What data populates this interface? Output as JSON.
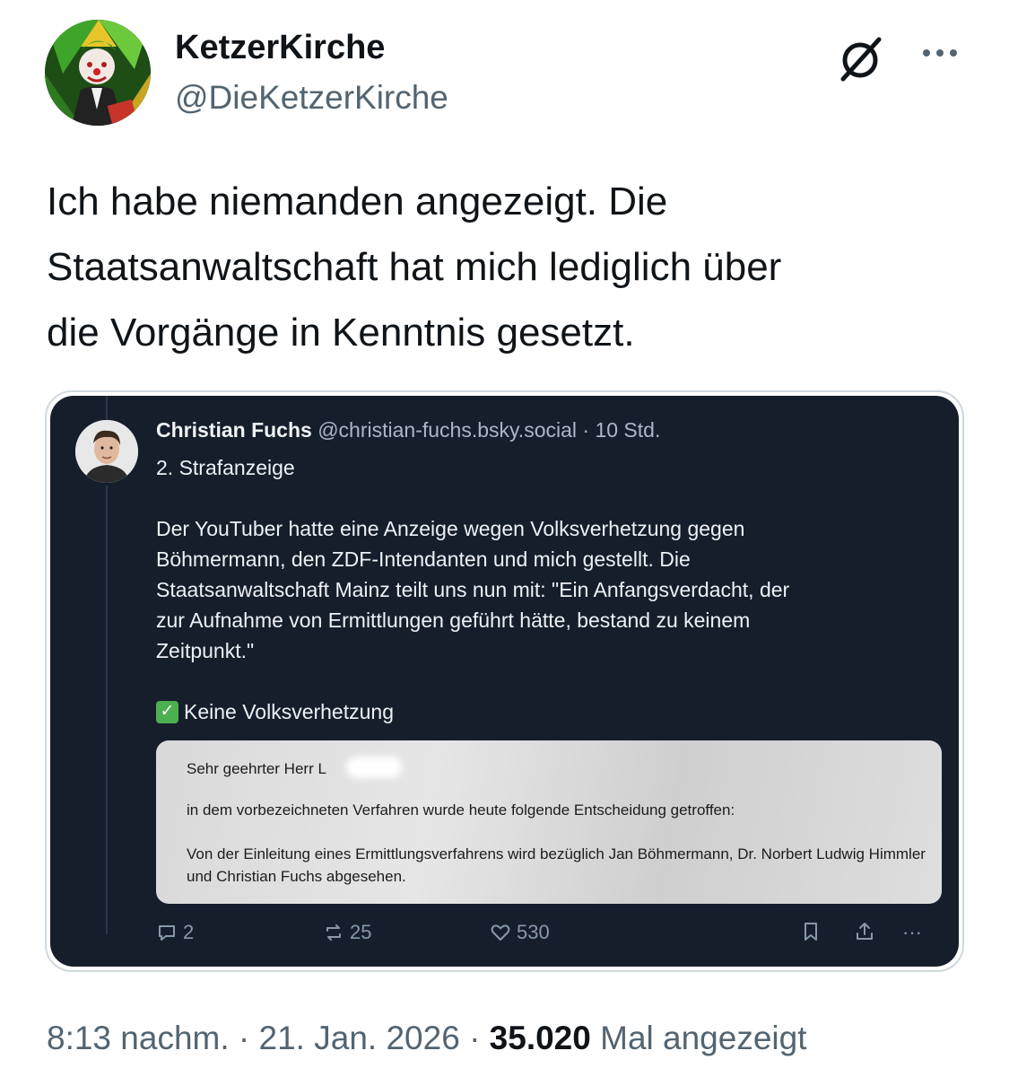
{
  "author": {
    "display_name": "KetzerKirche",
    "handle": "@DieKetzerKirche"
  },
  "tweet": {
    "text": "Ich habe niemanden angezeigt. Die\nStaatsanwaltschaft hat mich lediglich über\ndie Vorgänge in Kenntnis gesetzt."
  },
  "embed": {
    "name": "Christian Fuchs",
    "handle": "@christian-fuchs.bsky.social",
    "separator": "·",
    "time": "10 Std.",
    "line1": "2. Strafanzeige",
    "paragraph": "Der YouTuber hatte eine Anzeige wegen Volksverhetzung gegen\nBöhmermann, den ZDF-Intendanten und mich gestellt. Die\nStaatsanwaltschaft Mainz teilt uns nun mit: \"Ein Anfangsverdacht, der\nzur Aufnahme von Ermittlungen geführt hätte, bestand zu keinem\nZeitpunkt.\"",
    "check_label": "Keine Volksverhetzung",
    "check_mark": "✓",
    "letter": {
      "salutation": "Sehr geehrter Herr L",
      "line2": "in dem vorbezeichneten Verfahren wurde heute folgende Entscheidung getroffen:",
      "line3": "Von der Einleitung eines Ermittlungsverfahrens wird  bezüglich Jan Böhmermann, Dr. Norbert Ludwig Himmler und Christian Fuchs abgesehen."
    },
    "actions": {
      "replies": "2",
      "reposts": "25",
      "likes": "530",
      "more": "···"
    }
  },
  "meta": {
    "time": "8:13 nachm.",
    "dot1": "·",
    "date": "21. Jan. 2026",
    "dot2": "·",
    "views": "35.020",
    "views_label": "Mal angezeigt"
  },
  "icons": {
    "grok": "grok-icon",
    "more": "more-icon",
    "reply": "reply-icon",
    "repost": "repost-icon",
    "like": "heart-icon",
    "bookmark": "bookmark-icon",
    "share": "share-icon"
  },
  "colors": {
    "embed_background": "#161e2c",
    "secondary_text": "#536471",
    "check_green": "#4caf50"
  }
}
